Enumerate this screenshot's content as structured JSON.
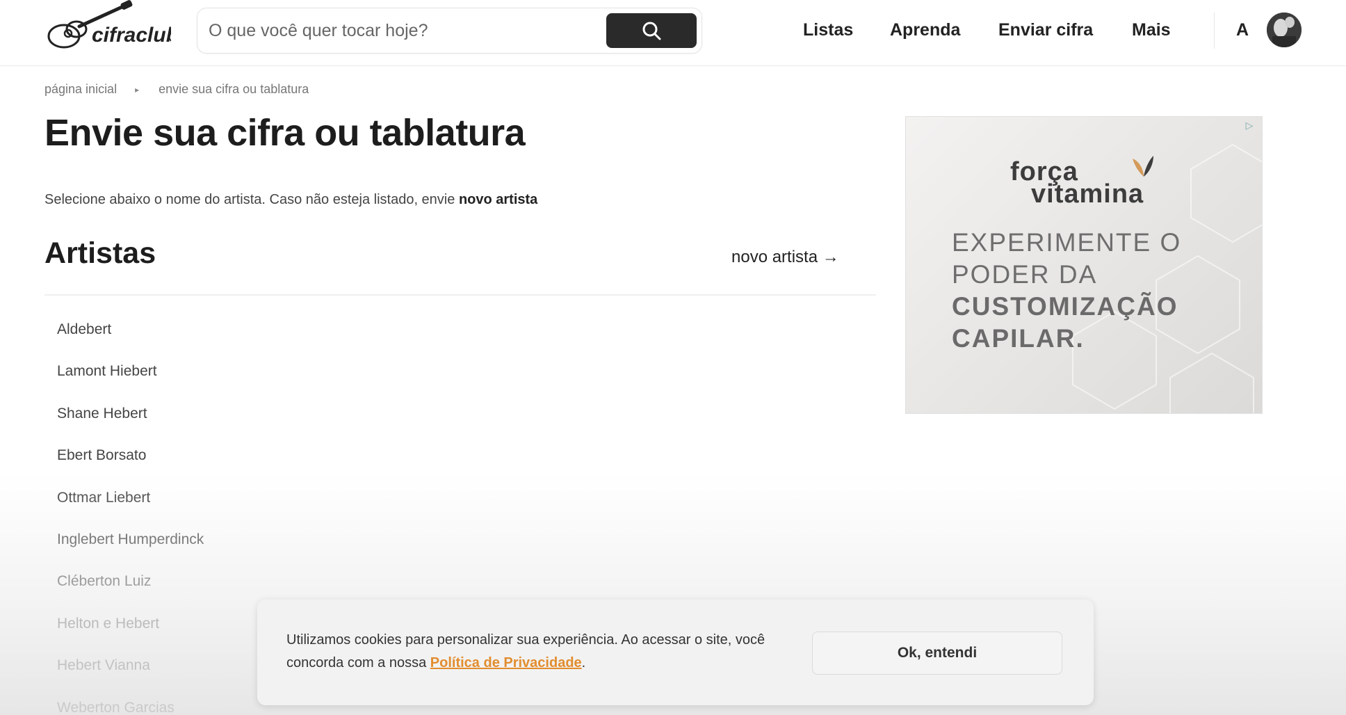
{
  "header": {
    "logo_text": "cifraclub",
    "search": {
      "placeholder": "O que você quer tocar hoje?",
      "value": ""
    },
    "nav": [
      "Listas",
      "Aprenda",
      "Enviar cifra",
      "Mais"
    ],
    "font_toggle": "A"
  },
  "breadcrumb": {
    "home": "página inicial",
    "separator": "▸",
    "current": "envie sua cifra ou tablatura"
  },
  "page": {
    "title": "Envie sua cifra ou tablatura",
    "intro": "Selecione abaixo o nome do artista. Caso não esteja listado, envie ",
    "intro_link": "novo artista",
    "section_title": "Artistas",
    "novo_artista_link": "novo artista →"
  },
  "artists": [
    "Aldebert",
    "Lamont Hiebert",
    "Shane Hebert",
    "Ebert Borsato",
    "Ottmar Liebert",
    "Inglebert Humperdinck",
    "Cléberton Luiz",
    "Helton e Hebert",
    "Hebert Vianna",
    "Weberton Garcias"
  ],
  "ad": {
    "brand_line1": "força",
    "brand_line2": "vitamina",
    "lines": [
      "EXPERIMENTE O",
      "PODER DA",
      "CUSTOMIZAÇÃO",
      "CAPILAR."
    ],
    "choices_icon": "ad-choices-icon"
  },
  "cookie": {
    "text_before": "Utilizamos cookies para personalizar sua experiência. Ao acessar o site, você concorda com a nossa ",
    "link": "Política de Privacidade",
    "text_after": ".",
    "button": "Ok, entendi"
  },
  "colors": {
    "accent": "#e28d2f",
    "search_button": "#2a2a2a"
  }
}
